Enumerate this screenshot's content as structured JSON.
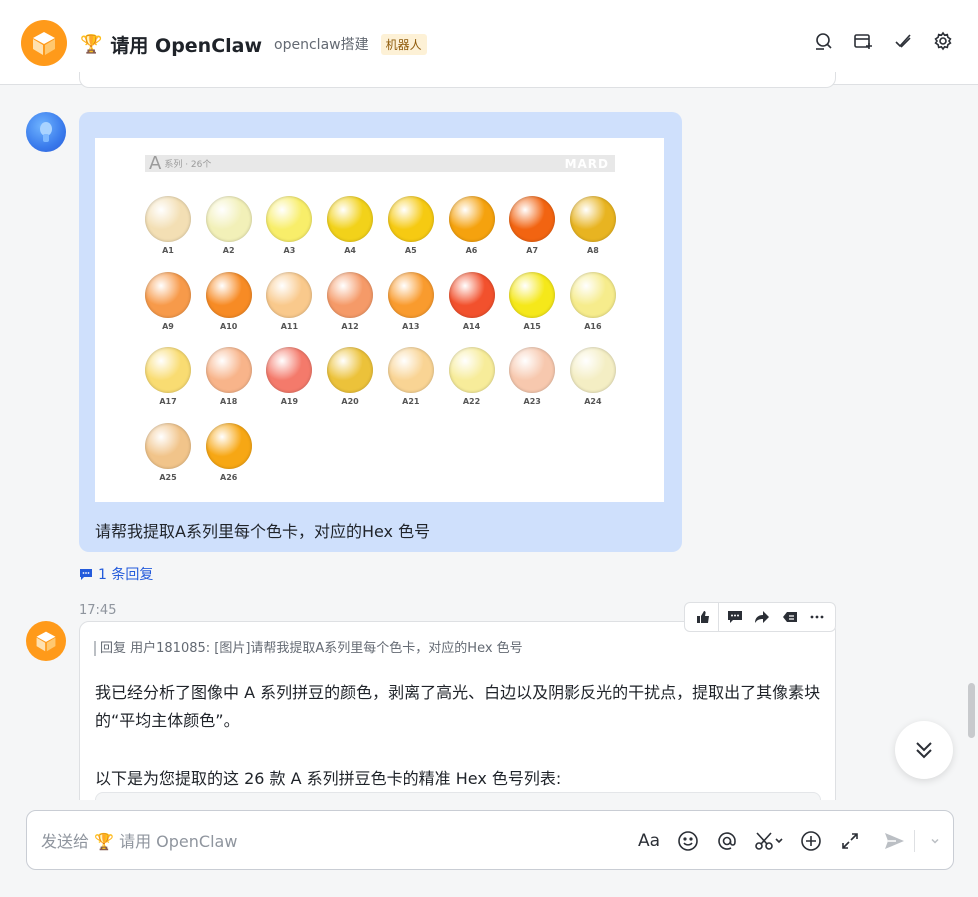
{
  "header": {
    "trophy_icon": "🏆",
    "title": "请用 OpenClaw",
    "subtitle": "openclaw搭建",
    "badge": "机器人"
  },
  "user_message": {
    "image": {
      "series_letter": "A",
      "series_text": "系列 · 26个",
      "brand": "MARD",
      "beads": [
        {
          "label": "A1",
          "color": "#f3dfb4"
        },
        {
          "label": "A2",
          "color": "#f2f0b8"
        },
        {
          "label": "A3",
          "color": "#f8ee6a"
        },
        {
          "label": "A4",
          "color": "#f2d21a"
        },
        {
          "label": "A5",
          "color": "#f6ca12"
        },
        {
          "label": "A6",
          "color": "#f5a20e"
        },
        {
          "label": "A7",
          "color": "#f26411"
        },
        {
          "label": "A8",
          "color": "#e8b421"
        },
        {
          "label": "A9",
          "color": "#f79a4a"
        },
        {
          "label": "A10",
          "color": "#f78b25"
        },
        {
          "label": "A11",
          "color": "#f9c98c"
        },
        {
          "label": "A12",
          "color": "#f59a68"
        },
        {
          "label": "A13",
          "color": "#f99b2e"
        },
        {
          "label": "A14",
          "color": "#f2512d"
        },
        {
          "label": "A15",
          "color": "#f5e81a"
        },
        {
          "label": "A16",
          "color": "#f6ec8c"
        },
        {
          "label": "A17",
          "color": "#f9dc72"
        },
        {
          "label": "A18",
          "color": "#f8b48a"
        },
        {
          "label": "A19",
          "color": "#f47a6b"
        },
        {
          "label": "A20",
          "color": "#ecc23a"
        },
        {
          "label": "A21",
          "color": "#f9d494"
        },
        {
          "label": "A22",
          "color": "#f7ec9a"
        },
        {
          "label": "A23",
          "color": "#f7c8ae"
        },
        {
          "label": "A24",
          "color": "#f4eec4"
        },
        {
          "label": "A25",
          "color": "#f1c48a"
        },
        {
          "label": "A26",
          "color": "#f7a714"
        }
      ]
    },
    "text": "请帮我提取A系列里每个色卡，对应的Hex 色号"
  },
  "reply_count": "1 条回复",
  "timestamp": "17:45",
  "bot_message": {
    "quote": "回复 用户181085: [图片]请帮我提取A系列里每个色卡，对应的Hex 色号",
    "para1": "我已经分析了图像中 A 系列拼豆的颜色，剥离了高光、白边以及阴影反光的干扰点，提取出了其像素块的“平均主体颜色”。",
    "para2": "以下是为您提取的这 26 款 A 系列拼豆色卡的精准 Hex 色号列表:"
  },
  "composer": {
    "placeholder": "发送给 🏆 请用 OpenClaw",
    "text_format_label": "Aa"
  },
  "colors": {
    "accent": "#245bdb",
    "bot_orange": "#ff9a1a",
    "user_bubble": "#cfe0fc"
  }
}
